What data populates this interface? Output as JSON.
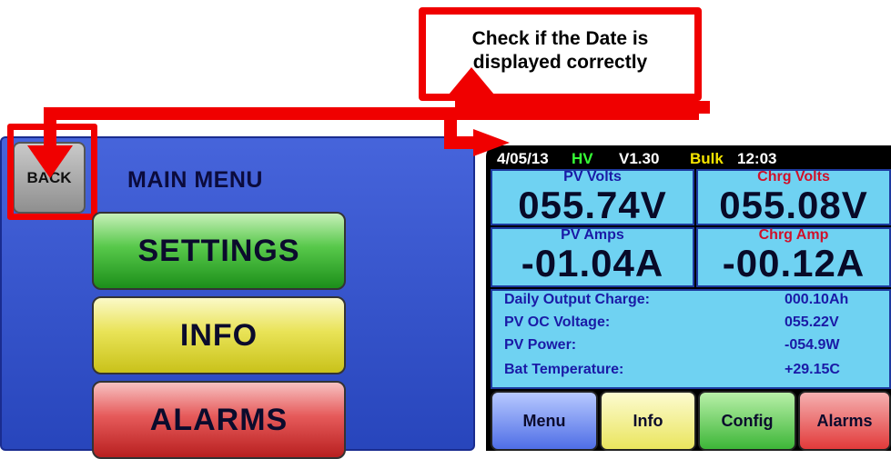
{
  "callout": {
    "text_line1": "Check if the Date is",
    "text_line2": "displayed correctly"
  },
  "main_menu": {
    "back_label": "BACK",
    "title": "MAIN MENU",
    "buttons": {
      "settings": "SETTINGS",
      "info": "INFO",
      "alarms": "ALARMS"
    }
  },
  "device_screen": {
    "status_bar": {
      "date": "4/05/13",
      "mode": "HV",
      "version": "V1.30",
      "stage": "Bulk",
      "time": "12:03"
    },
    "panels": {
      "pv_volts": {
        "label": "PV Volts",
        "value": "055.74V"
      },
      "chrg_volts": {
        "label": "Chrg Volts",
        "value": "055.08V"
      },
      "pv_amps": {
        "label": "PV Amps",
        "value": "-01.04A"
      },
      "chrg_amp": {
        "label": "Chrg Amp",
        "value": "-00.12A"
      }
    },
    "info_rows": [
      {
        "label": "Daily Output Charge:",
        "value": "000.10Ah"
      },
      {
        "label": "PV OC Voltage:",
        "value": "055.22V"
      },
      {
        "label": "PV Power:",
        "value": "-054.9W"
      },
      {
        "label": "Bat Temperature:",
        "value": "+29.15C"
      }
    ],
    "nav_buttons": {
      "menu": "Menu",
      "info": "Info",
      "config": "Config",
      "alarms": "Alarms"
    }
  },
  "colors": {
    "highlight": "#f00000",
    "left_screen_bg": "#2d4fd6",
    "panel_bg": "#6fd2f2",
    "hv_color": "#36ff36",
    "bulk_color": "#f5e400"
  }
}
